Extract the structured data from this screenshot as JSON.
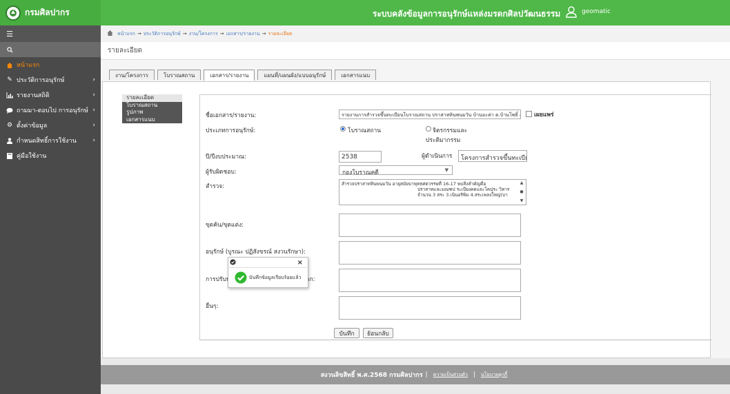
{
  "app": {
    "brand": "กรมศิลปากร",
    "system_title": "ระบบคลังข้อมูลการอนุรักษ์แหล่งมรดกศิลปวัฒนธรรม",
    "user": "geomatic"
  },
  "sidebar": {
    "items": [
      {
        "label": "หน้าแรก",
        "icon": "home-icon",
        "caret": ""
      },
      {
        "label": "ประวัติการอนุรักษ์",
        "icon": "edit-icon",
        "caret": "›"
      },
      {
        "label": "รายงานสถิติ",
        "icon": "chart-icon",
        "caret": "›"
      },
      {
        "label": "ถามมา-ตอบไป การอนุรักษ์",
        "icon": "comment-icon",
        "caret": "›"
      },
      {
        "label": "ตั้งค่าข้อมูล",
        "icon": "gear-icon",
        "caret": "›"
      },
      {
        "label": "กำหนดสิทธิ์การใช้งาน",
        "icon": "user-icon",
        "caret": "›"
      },
      {
        "label": "คู่มือใช้งาน",
        "icon": "book-icon",
        "caret": ""
      }
    ]
  },
  "breadcrumb": {
    "items": [
      "หน้าแรก",
      "ประวัติการอนุรักษ์",
      "งาน/โครงการ",
      "เอกสาร/รายงาน"
    ],
    "current": "รายละเอียด"
  },
  "page_title": "รายละเอียด",
  "tabs": [
    "งาน/โครงการ",
    "โบราณสถาน",
    "เอกสาร/รายงาน",
    "แผนที่/แผนผัง/แบบอนุรักษ์",
    "เอกสารแนบ"
  ],
  "subnav": [
    "รายละเอียด",
    "โบราณสถาน",
    "รูปภาพ",
    "เอกสารแนบ"
  ],
  "form": {
    "doc_name_label": "ชื่อเอกสาร/รายงาน:",
    "doc_name_value": "รายงานการสำรวจขึ้นทะเบียนโบราณสถาน ปราสาทหินพนมวัน บ้านมะค่า ต.บ้านโพธิ์ อ.เมือง",
    "publish_label": "เผยแพร่",
    "type_label": "ประเภทการอนุรักษ์:",
    "type_opt1": "โบราณสถาน",
    "type_opt2_line1": "จิตรกรรมและ",
    "type_opt2_line2": "ประติมากรรม",
    "year_label": "ปี/ปีงบประมาณ:",
    "year_value": "2538",
    "operator_label": "ผู้ดำเนินการ",
    "operator_value": "โครงการสำรวจขึ้นทะเบียน",
    "responsible_label": "ผู้รับผิดชอบ:",
    "responsible_value": "กองโบราณคดี",
    "survey_label": "สำรวจ:",
    "survey_lines": [
      "สำรวจปราสาทหินพนมวัน อายุสมัยบาพุทธศตวรรษที่ 16-17 พบสิ่งสำคัญคือ",
      "ปราสาทและมณฑป ระเบียงคดและโคปุระ วิหาร",
      "จำนวน 3 สระ 3.เนินอริพิม 4.สระเพลงใหญ่(บา"
    ],
    "excavation_label": "ขุดค้น/ขุดแต่ง:",
    "conserve_label": "อนุรักษ์ (บูรณะ ปฏิสังขรณ์ สงวนรักษา):",
    "landscape_label": "การปรับปรุงภูมิทัศน์/สิ่งอำนวยความสะดวก:",
    "other_label": "อื่นๆ:",
    "save_button": "บันทึก",
    "back_button": "ย้อนกลับ"
  },
  "popup": {
    "message": "บันทึกข้อมูลเรียบร้อยแล้ว",
    "close": "×"
  },
  "footer": {
    "copyright": "สงวนลิขสิทธิ์ พ.ศ.2568 กรมศิลปากร",
    "link1": "ความเป็นส่วนตัว",
    "link2": "นโยบายคุกกี้",
    "sep": "|"
  },
  "colors": {
    "header_green": "#4fb848",
    "sidebar_dark": "#4a4a4a",
    "active_orange": "#ff8a00",
    "footer_gray": "#999999"
  }
}
